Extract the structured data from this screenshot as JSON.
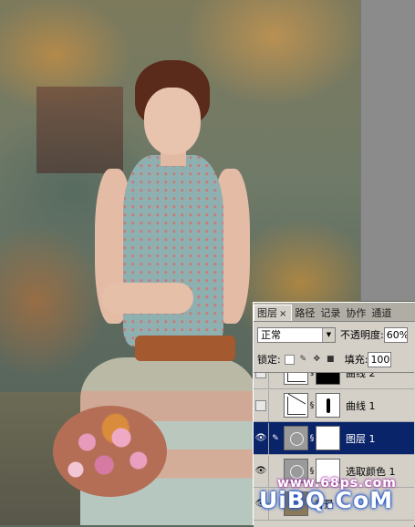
{
  "panel": {
    "tabs": [
      {
        "label": "图层",
        "active": true
      },
      {
        "label": "路径",
        "active": false
      },
      {
        "label": "记录",
        "active": false
      },
      {
        "label": "协作",
        "active": false
      },
      {
        "label": "通道",
        "active": false
      }
    ],
    "tab_close": "×",
    "blend_mode": "正常",
    "opacity_label": "不透明度:",
    "opacity_value": "60%",
    "lock_label": "锁定:",
    "fill_label": "填充:",
    "fill_value": "100%",
    "layers": [
      {
        "name": "曲线 2",
        "visible": false,
        "selected": false
      },
      {
        "name": "曲线 1",
        "visible": false,
        "selected": false
      },
      {
        "name": "图层 1",
        "visible": true,
        "selected": true
      },
      {
        "name": "选取颜色 1",
        "visible": true,
        "selected": false
      },
      {
        "name": "背景",
        "visible": true,
        "selected": false
      }
    ]
  },
  "watermark": {
    "small": "www.68ps.com",
    "big": "UiBQ.CoM"
  },
  "colors": {
    "selection": "#0a246a",
    "panel_bg": "#d4d0c8",
    "watermark_glow": "#1f55c8"
  }
}
